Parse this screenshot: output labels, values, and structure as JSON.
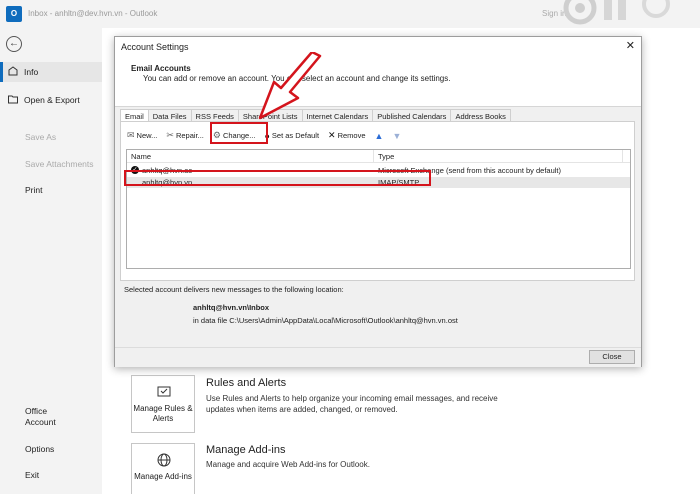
{
  "titlebar": {
    "title": "Inbox - anhltn@dev.hvn.vn  -  Outlook",
    "signin": "Sign in"
  },
  "sidebar": {
    "back_icon": "back-arrow-icon",
    "items": [
      {
        "label": "Info",
        "icon": "info-icon"
      },
      {
        "label": "Open & Export",
        "icon": "folder-open-icon"
      },
      {
        "label": "Save As"
      },
      {
        "label": "Save Attachments"
      },
      {
        "label": "Print"
      },
      {
        "label": "Office Account"
      },
      {
        "label": "Options"
      },
      {
        "label": "Exit"
      }
    ]
  },
  "features": [
    {
      "button": "Manage Rules & Alerts",
      "title": "Rules and Alerts",
      "desc": "Use Rules and Alerts to help organize your incoming email messages, and receive updates when items are added, changed, or removed."
    },
    {
      "button": "Manage Add-ins",
      "title": "Manage Add-ins",
      "desc": "Manage and acquire Web Add-ins for Outlook."
    }
  ],
  "dialog": {
    "title": "Account Settings",
    "close_glyph": "✕",
    "header_title": "Email Accounts",
    "header_desc": "You can add or remove an account. You can select an account and change its settings.",
    "tabs": [
      "Email",
      "Data Files",
      "RSS Feeds",
      "SharePoint Lists",
      "Internet Calendars",
      "Published Calendars",
      "Address Books"
    ],
    "toolbar": {
      "new": "New...",
      "repair": "Repair...",
      "change": "Change...",
      "set_default": "Set as Default",
      "remove": "Remove"
    },
    "columns": {
      "name": "Name",
      "type": "Type"
    },
    "accounts": [
      {
        "name": "anhltq@hvn.ac",
        "type": "Microsoft Exchange (send from this account by default)"
      },
      {
        "name": "anhltq@hvn.vn",
        "type": "IMAP/SMTP"
      }
    ],
    "deliver_text": "Selected account delivers new messages to the following location:",
    "deliver_folder": "anhltq@hvn.vn\\Inbox",
    "deliver_path": "in data file C:\\Users\\Admin\\AppData\\Local\\Microsoft\\Outlook\\anhltq@hvn.vn.ost",
    "close_button": "Close"
  },
  "annotation_color": "#d4141c"
}
